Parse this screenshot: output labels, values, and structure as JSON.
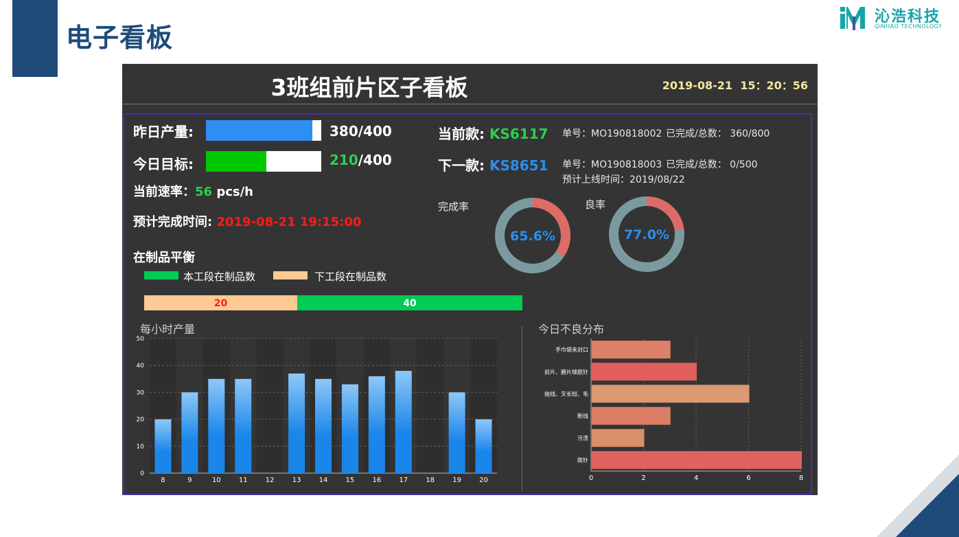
{
  "slide": {
    "title": "电子看板"
  },
  "brand": {
    "name": "沁浩科技",
    "sub": "QINHAO TECHNOLOGY",
    "color": "#14a6a8"
  },
  "board": {
    "title": "3班组前片区子看板",
    "datetime": "2019-08-21  15：20：56"
  },
  "yesterday": {
    "label": "昨日产量:",
    "done": 380,
    "total": 400,
    "done_text": "380",
    "total_text": "/400"
  },
  "today": {
    "label": "今日目标:",
    "done": 210,
    "total": 400,
    "done_text": "210",
    "total_text": "/400"
  },
  "rate": {
    "label": "当前速率：",
    "value": "56",
    "unit": " pcs/h"
  },
  "eta": {
    "label": "预计完成时间:",
    "value": "2019-08-21 19:15:00"
  },
  "current": {
    "label": "当前款:",
    "code": "KS6117",
    "order": "单号：MO190818002",
    "progress": "已完成/总数：  360/800"
  },
  "next": {
    "label": "下一款:",
    "code": "KS8651",
    "order": "单号：MO190818003",
    "progress": "已完成/总数：  0/500",
    "eta": "预计上线时间：2019/08/22"
  },
  "completion": {
    "label": "完成率",
    "value": 65.6,
    "text": "65.6%"
  },
  "yield": {
    "label": "良率",
    "value": 77.0,
    "text": "77.0%"
  },
  "wip": {
    "title": "在制品平衡",
    "legend_current": "本工段在制品数",
    "legend_next": "下工段在制品数",
    "next_value": 20,
    "current_value": 40,
    "next_text": "20",
    "current_text": "40",
    "color_current": "#00cc55",
    "color_next": "#ffc994"
  },
  "hourly": {
    "title": "每小时产量"
  },
  "defects": {
    "title": "今日不良分布"
  },
  "chart_data": [
    {
      "type": "bar",
      "title": "每小时产量",
      "categories": [
        "8",
        "9",
        "10",
        "11",
        "12",
        "13",
        "14",
        "15",
        "16",
        "17",
        "18",
        "19",
        "20"
      ],
      "values": [
        20,
        30,
        35,
        35,
        0,
        37,
        35,
        33,
        36,
        38,
        0,
        30,
        20
      ],
      "ylim": [
        0,
        50
      ],
      "yticks": [
        "0",
        "10",
        "20",
        "30",
        "40",
        "50"
      ],
      "grid": true,
      "colors": {
        "top": "#8ec8f7",
        "bottom": "#1b86ea"
      }
    },
    {
      "type": "bar",
      "orientation": "horizontal",
      "title": "今日不良分布",
      "categories": [
        "手巾袋未封口",
        "前片、腋片缝脱针",
        "抛线、叉长短、毛",
        "断线",
        "污渍",
        "跳针"
      ],
      "values": [
        3,
        4,
        6,
        3,
        2,
        8
      ],
      "xlim": [
        0,
        8
      ],
      "xticks": [
        "0",
        "2",
        "4",
        "6",
        "8"
      ],
      "colors": [
        "#dc8068",
        "#e05f5c",
        "#db9a72",
        "#dc7e66",
        "#d9906a",
        "#e0625f"
      ]
    }
  ]
}
